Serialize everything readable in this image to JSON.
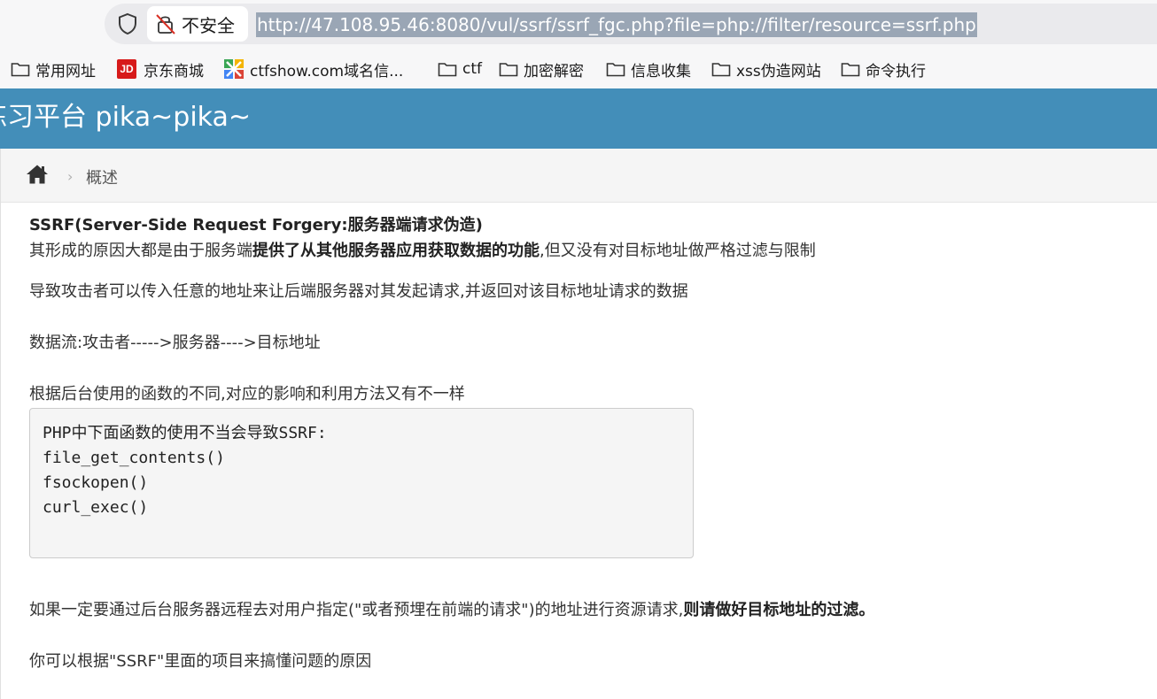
{
  "browser": {
    "security_label": "不安全",
    "url": "http://47.108.95.46:8080/vul/ssrf/ssrf_fgc.php?file=php://filter/resource=ssrf.php",
    "bookmarks": [
      {
        "label": "常用网址",
        "icon": "folder-icon"
      },
      {
        "label": "京东商城",
        "icon": "jd-icon",
        "badge": "JD"
      },
      {
        "label": "ctfshow.com域名信...",
        "icon": "ctfshow-icon"
      },
      {
        "label": "ctf",
        "icon": "folder-icon"
      },
      {
        "label": "加密解密",
        "icon": "folder-icon"
      },
      {
        "label": "信息收集",
        "icon": "folder-icon"
      },
      {
        "label": "xss伪造网站",
        "icon": "folder-icon"
      },
      {
        "label": "命令执行",
        "icon": "folder-icon"
      }
    ]
  },
  "site": {
    "title": "练习平台 pika~pika~",
    "brand_color": "#438eb9"
  },
  "breadcrumb": {
    "home_icon": "home-icon",
    "current": "概述"
  },
  "content": {
    "heading_prefix": "SSRF(Server-Side Request Forgery:",
    "heading_bold": "服务器端请求伪造)",
    "p1_a": "其形成的原因大都是由于服务端",
    "p1_b": "提供了从其他服务器应用获取数据的功能",
    "p1_c": ",但又没有对目标地址做严格过滤与限制",
    "p2": "导致攻击者可以传入任意的地址来让后端服务器对其发起请求,并返回对该目标地址请求的数据",
    "p3": "数据流:攻击者----->服务器---->目标地址",
    "p4": "根据后台使用的函数的不同,对应的影响和利用方法又有不一样",
    "code": [
      "PHP中下面函数的使用不当会导致SSRF:",
      "file_get_contents()",
      "fsockopen()",
      "curl_exec()"
    ],
    "p5_a": "如果一定要通过后台服务器远程去对用户指定(\"或者预埋在前端的请求\")的地址进行资源请求,",
    "p5_b": "则请做好目标地址的过滤。",
    "p6": "你可以根据\"SSRF\"里面的项目来搞懂问题的原因"
  }
}
